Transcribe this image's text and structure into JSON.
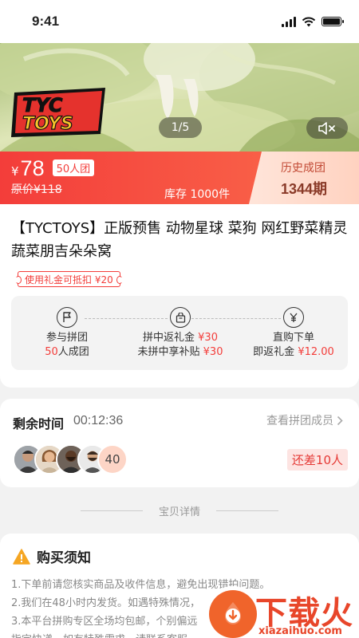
{
  "status_bar": {
    "time": "9:41"
  },
  "hero": {
    "brand_logo_text": [
      "TYC",
      "TOYS"
    ],
    "page_indicator": "1/5"
  },
  "price": {
    "currency": "¥",
    "value": "78",
    "group_badge": "50人团",
    "original_price": "原价¥118",
    "stock": "库存 1000件",
    "history_label": "历史成团",
    "history_value": "1344期"
  },
  "product": {
    "title": "【TYCTOYS】正版预售 动物星球 菜狗 网红野菜精灵蔬菜朋吉朵朵窝",
    "coupon": "使用礼金可抵扣 ¥20"
  },
  "steps": [
    {
      "icon": "flag-icon",
      "line1": "参与拼团",
      "line2_red": "50",
      "line2_rest": "人成团"
    },
    {
      "icon": "gift-icon",
      "line1_prefix": "拼中返礼金",
      "line1_red": "¥30",
      "line2_prefix": "未拼中享补贴",
      "line2_red": "¥30"
    },
    {
      "icon": "yen-icon",
      "line1": "直购下单",
      "line2_prefix": "即返礼金",
      "line2_red": "¥12.00"
    }
  ],
  "group": {
    "remain_label": "剩余时间",
    "remain_time": "00:12:36",
    "view_members": "查看拼团成员",
    "member_count": "40",
    "short_badge": "还差10人"
  },
  "divider_label": "宝贝详情",
  "notice": {
    "title": "购买须知",
    "items": [
      "1.下单前请您核实商品及收件信息，避免出现错拍问题。",
      "2.我们在48小时内发货。如遇特殊情况，",
      "3.本平台拼购专区全场均包邮，个别偏远",
      "指定快递，如有特殊需求，请联系客服"
    ]
  },
  "watermark": {
    "text": "下载火",
    "domain": "xiazaihuo.com"
  },
  "colors": {
    "accent": "#f33d3a",
    "history_bg": "#ffdccc",
    "watermark": "#e8462a"
  }
}
